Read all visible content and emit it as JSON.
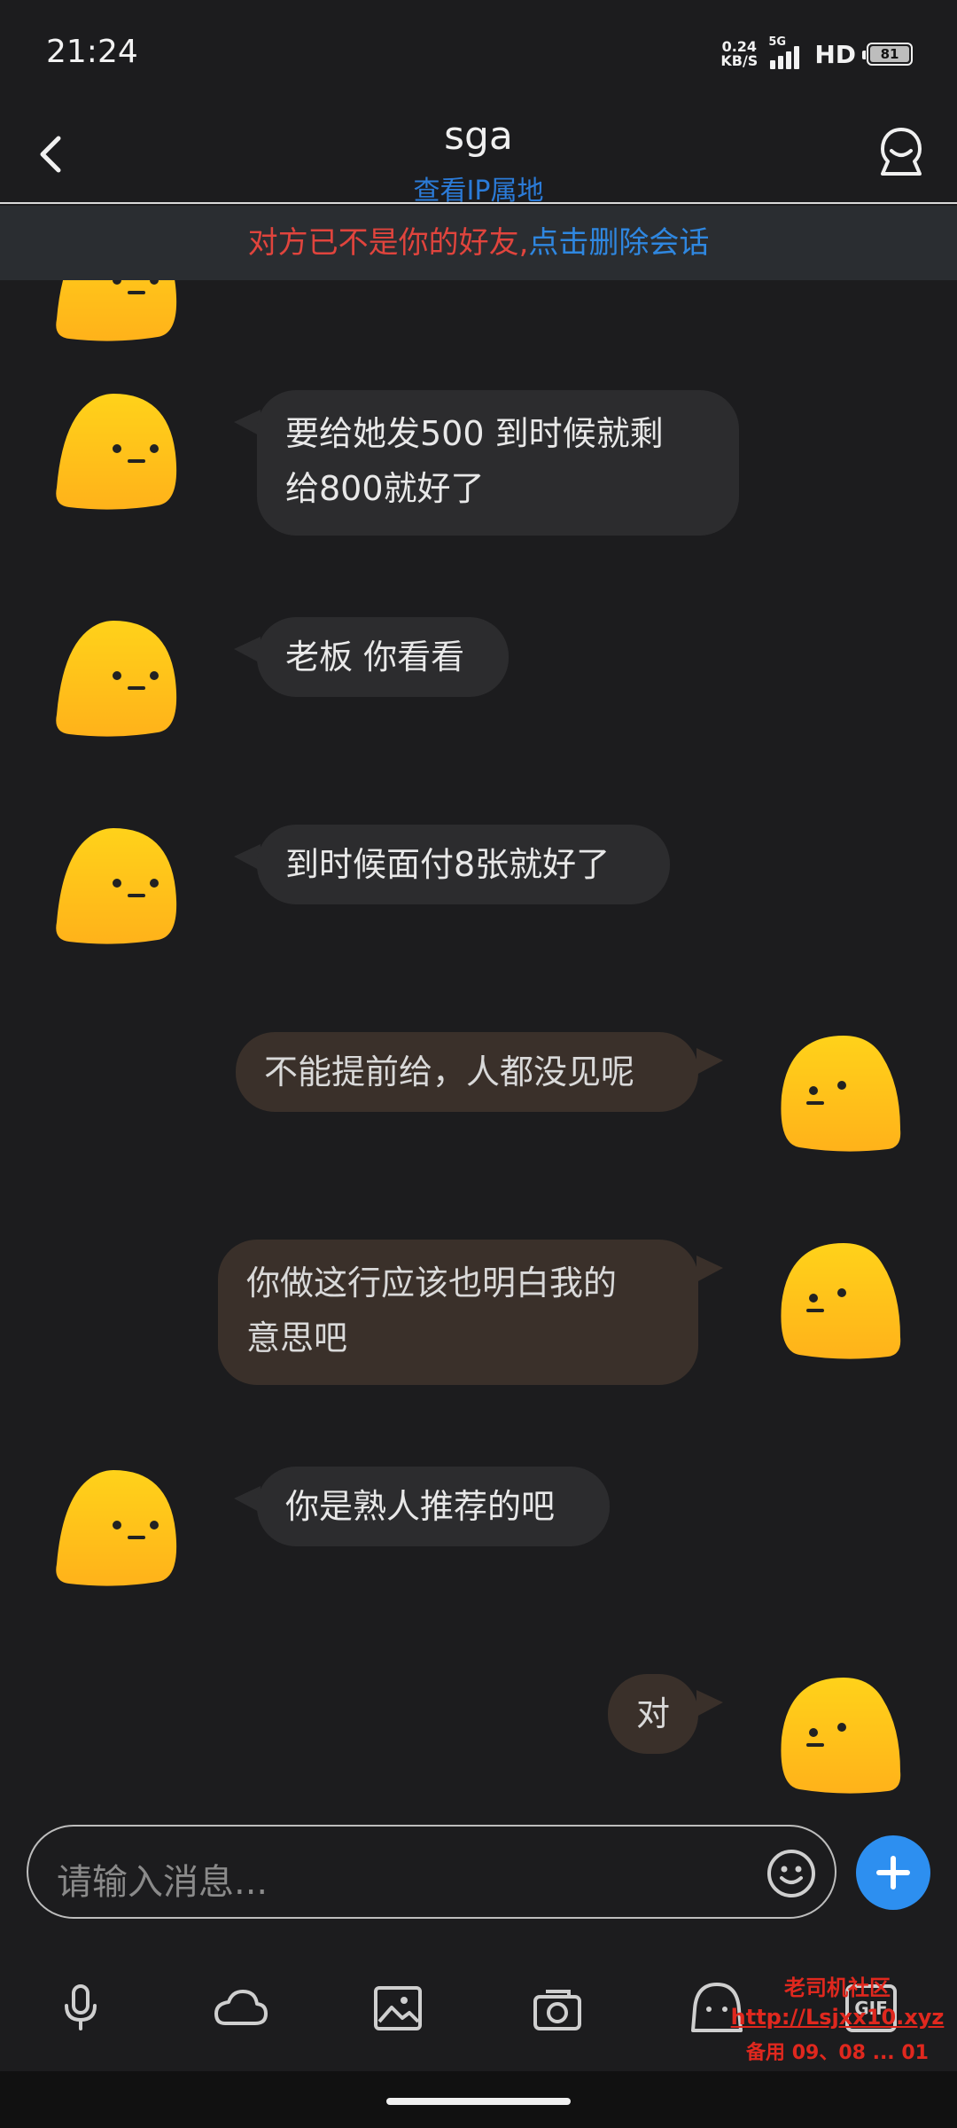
{
  "status_bar": {
    "time": "21:24",
    "net_speed_value": "0.24",
    "net_speed_unit": "KB/S",
    "network_type": "5G",
    "hd_label": "HD",
    "battery": "81"
  },
  "header": {
    "title": "sga",
    "subtitle": "查看IP属地",
    "back_icon": "chevron-left-icon",
    "profile_icon": "profile-icon"
  },
  "notice": {
    "warning_text": "对方已不是你的好友,",
    "action_text": "点击删除会话"
  },
  "messages": [
    {
      "direction": "in",
      "lines": [
        "要给她发500 到时候就剩",
        "给800就好了"
      ]
    },
    {
      "direction": "in",
      "lines": [
        "老板 你看看"
      ]
    },
    {
      "direction": "in",
      "lines": [
        "到时候面付8张就好了"
      ]
    },
    {
      "direction": "out",
      "lines": [
        "不能提前给，人都没见呢"
      ]
    },
    {
      "direction": "out",
      "lines": [
        "你做这行应该也明白我的",
        "意思吧"
      ]
    },
    {
      "direction": "in",
      "lines": [
        "你是熟人推荐的吧"
      ]
    },
    {
      "direction": "out",
      "lines": [
        "对"
      ]
    }
  ],
  "input": {
    "placeholder": "请输入消息..."
  },
  "toolbar": {
    "items": [
      "microphone-icon",
      "cloud-icon",
      "image-icon",
      "camera-icon",
      "sticker-icon",
      "gif-icon"
    ],
    "gif_label": "GIF"
  },
  "watermark": {
    "line1": "老司机社区",
    "line2": "http://Lsjxx10.xyz",
    "line3": "备用 09、08 ... 01"
  },
  "colors": {
    "background": "#1c1c1e",
    "incoming_bubble": "#2c2c2e",
    "outgoing_bubble": "#3a302a",
    "link_blue": "#2f87e0",
    "warning_red": "#e0443d",
    "avatar_yellow": "#ffc21a"
  }
}
